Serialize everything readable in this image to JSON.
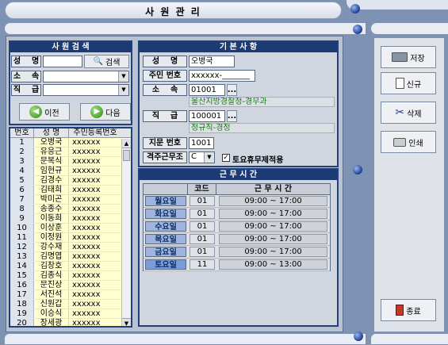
{
  "title": "사 원 관 리",
  "search": {
    "title": "사 원 검 색",
    "name_label": "성    명",
    "name_value": "",
    "search_btn": "검색",
    "dept_label": "소    속",
    "dept_value": "",
    "grade_label": "직    급",
    "grade_value": "",
    "prev_btn": "이전",
    "next_btn": "다음"
  },
  "list": {
    "headers": [
      "번호",
      "성  명",
      "주민등록번호"
    ],
    "rows": [
      {
        "no": "1",
        "name": "오병국",
        "id": "xxxxxx"
      },
      {
        "no": "2",
        "name": "유응근",
        "id": "xxxxxx"
      },
      {
        "no": "3",
        "name": "문복식",
        "id": "xxxxxx"
      },
      {
        "no": "4",
        "name": "임현규",
        "id": "xxxxxx"
      },
      {
        "no": "5",
        "name": "김경수",
        "id": "xxxxxx"
      },
      {
        "no": "6",
        "name": "김태희",
        "id": "xxxxxx"
      },
      {
        "no": "7",
        "name": "박미곤",
        "id": "xxxxxx"
      },
      {
        "no": "8",
        "name": "송종수",
        "id": "xxxxxx"
      },
      {
        "no": "9",
        "name": "이동희",
        "id": "xxxxxx"
      },
      {
        "no": "10",
        "name": "이상훈",
        "id": "xxxxxx"
      },
      {
        "no": "11",
        "name": "이정원",
        "id": "xxxxxx"
      },
      {
        "no": "12",
        "name": "강수재",
        "id": "xxxxxx"
      },
      {
        "no": "13",
        "name": "김명엽",
        "id": "xxxxxx"
      },
      {
        "no": "14",
        "name": "김창호",
        "id": "xxxxxx"
      },
      {
        "no": "15",
        "name": "김종식",
        "id": "xxxxxx"
      },
      {
        "no": "16",
        "name": "문진상",
        "id": "xxxxxx"
      },
      {
        "no": "17",
        "name": "서진석",
        "id": "xxxxxx"
      },
      {
        "no": "18",
        "name": "신원갑",
        "id": "xxxxxx"
      },
      {
        "no": "19",
        "name": "이승식",
        "id": "xxxxxx"
      },
      {
        "no": "20",
        "name": "장세광",
        "id": "xxxxxx"
      }
    ]
  },
  "basic": {
    "title": "기 본 사 항",
    "name_label": "성    명",
    "name_value": "오병국",
    "ssn_label": "주민 번호",
    "ssn_value": "xxxxxx-_______",
    "dept_label": "소    속",
    "dept_code": "01001",
    "dept_name": "울산지방경찰청-경무과",
    "grade_label": "직    급",
    "grade_code": "100001",
    "grade_name": "정규직-경정",
    "finger_label": "지문 번호",
    "finger_value": "1001",
    "shift_label": "격주근무조",
    "shift_value": "C",
    "sat_label": "토요휴무제적용",
    "sat_checked": true,
    "lookup_btn": "..."
  },
  "work": {
    "title": "근 무 시 간",
    "headers": [
      "",
      "코드",
      "근 무 시 간"
    ],
    "rows": [
      {
        "day": "월요일",
        "code": "01",
        "time": "09:00 ~ 17:00",
        "sat": false
      },
      {
        "day": "화요일",
        "code": "01",
        "time": "09:00 ~ 17:00",
        "sat": false
      },
      {
        "day": "수요일",
        "code": "01",
        "time": "09:00 ~ 17:00",
        "sat": false
      },
      {
        "day": "목요일",
        "code": "01",
        "time": "09:00 ~ 17:00",
        "sat": false
      },
      {
        "day": "금요일",
        "code": "01",
        "time": "09:00 ~ 17:00",
        "sat": false
      },
      {
        "day": "토요일",
        "code": "11",
        "time": "09:00 ~ 13:00",
        "sat": true
      }
    ]
  },
  "actions": {
    "save": "저장",
    "new": "신규",
    "delete": "삭제",
    "print": "인쇄",
    "exit": "종료"
  }
}
